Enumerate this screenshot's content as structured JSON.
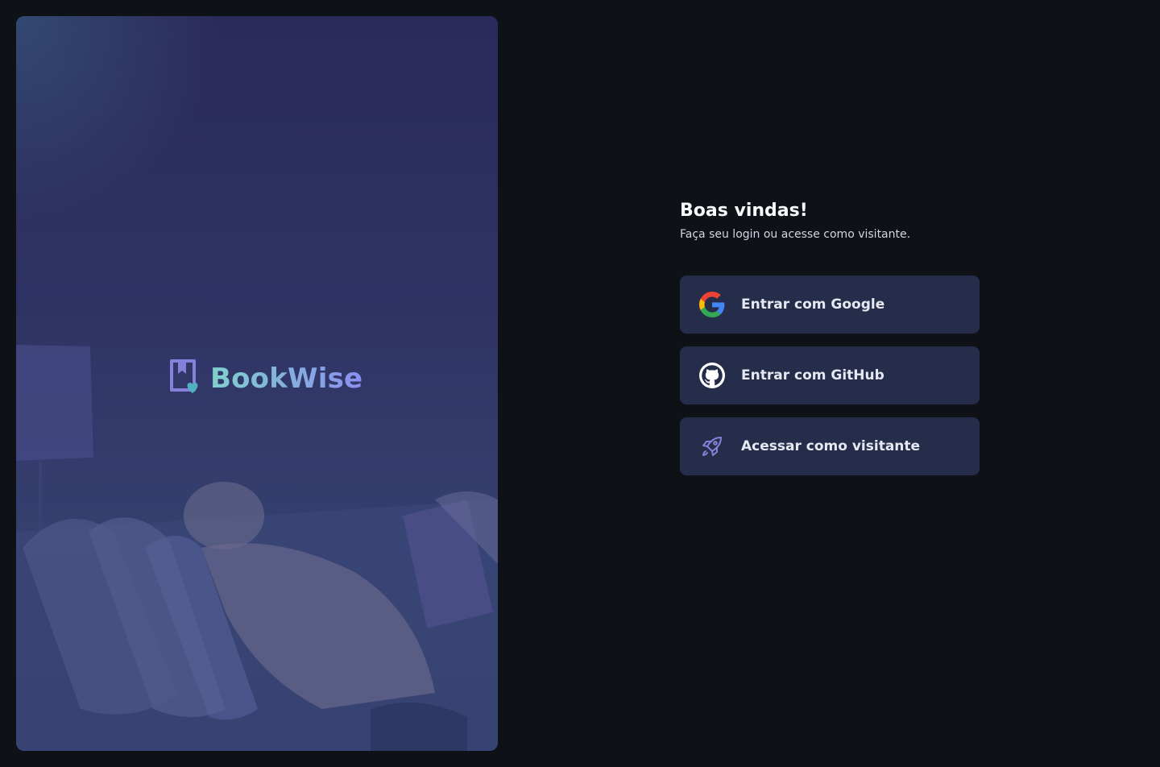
{
  "brand": {
    "name": "BookWise",
    "icon": "bookmark-heart-icon",
    "gradient": [
      "#7fd1cc",
      "#8b8ff0"
    ]
  },
  "hero": {
    "image": "woman-reading-on-couch"
  },
  "login": {
    "title": "Boas vindas!",
    "subtitle": "Faça seu login ou acesse como visitante.",
    "options": [
      {
        "icon": "google-icon",
        "label": "Entrar com Google"
      },
      {
        "icon": "github-icon",
        "label": "Entrar com GitHub"
      },
      {
        "icon": "rocket-icon",
        "label": "Acessar como visitante"
      }
    ]
  },
  "colors": {
    "background": "#0e1116",
    "button": "#252d4a",
    "accent": "#8381d9"
  }
}
